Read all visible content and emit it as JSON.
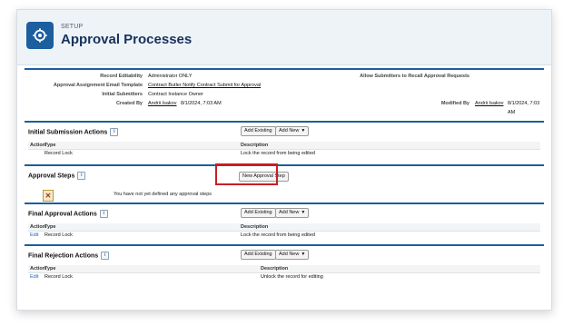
{
  "header": {
    "eyebrow": "SETUP",
    "title": "Approval Processes"
  },
  "details": {
    "record_editability_label": "Record Editability",
    "record_editability_value": "Administrator ONLY",
    "recall_label": "Allow Submitters to Recall Approval Requests",
    "email_template_label": "Approval Assignment Email Template",
    "email_template_value": "Contract Butler Notify Contract Submit for Approval",
    "initial_submitters_label": "Initial Submitters",
    "initial_submitters_value": "Contract Instance Owner",
    "created_by_label": "Created By",
    "created_by_user": "Andrii Isakov",
    "created_by_date": "8/1/2024, 7:03 AM",
    "modified_by_label": "Modified By",
    "modified_by_user": "Andrii Isakov",
    "modified_by_date": "8/1/2024, 7:03 AM"
  },
  "sections": {
    "initial": {
      "title": "Initial Submission Actions",
      "add_existing": "Add Existing",
      "add_new": "Add New",
      "col_action": "Action",
      "col_type": "Type",
      "col_description": "Description",
      "row_action": "",
      "row_type": "Record Lock",
      "row_description": "Lock the record from being edited"
    },
    "steps": {
      "title": "Approval Steps",
      "new_step_button": "New Approval Step",
      "empty_message": "You have not yet defined any approval steps"
    },
    "final_approval": {
      "title": "Final Approval Actions",
      "add_existing": "Add Existing",
      "add_new": "Add New",
      "col_action": "Action",
      "col_type": "Type",
      "col_description": "Description",
      "row_action": "Edit",
      "row_type": "Record Lock",
      "row_description": "Lock the record from being edited"
    },
    "final_rejection": {
      "title": "Final Rejection Actions",
      "add_existing": "Add Existing",
      "add_new": "Add New",
      "col_action": "Action",
      "col_type": "Type",
      "col_description": "Description",
      "row_action": "Edit",
      "row_type": "Record Lock",
      "row_description": "Unlock the record for editing"
    }
  },
  "help_glyph": "i",
  "caret_glyph": "▼",
  "icons": {
    "header": "settings-gear-icon",
    "help": "info-icon",
    "empty": "error-x-icon"
  },
  "colors": {
    "brand": "#1c5e9e",
    "highlight": "#c42025",
    "link": "#1565c0"
  }
}
